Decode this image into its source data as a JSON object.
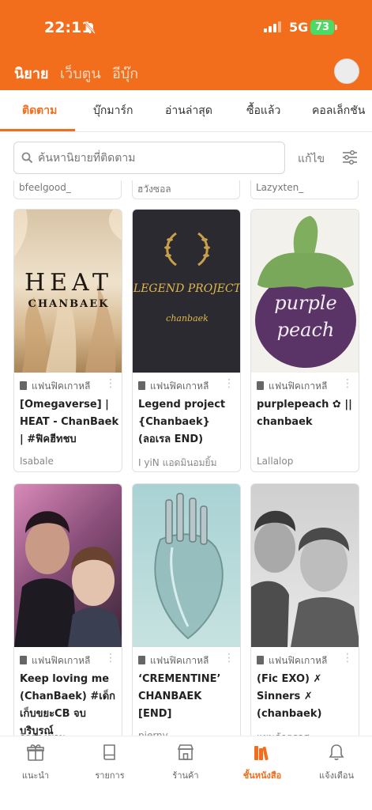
{
  "status_bar": {
    "time": "22:11",
    "network": "5G",
    "battery": "73"
  },
  "header": {
    "tabs": [
      {
        "label": "นิยาย",
        "active": true
      },
      {
        "label": "เว็บตูน",
        "active": false
      },
      {
        "label": "อีบุ๊ก",
        "active": false
      }
    ]
  },
  "subtabs": [
    "ติดตาม",
    "บุ๊กมาร์ก",
    "อ่านล่าสุด",
    "ซื้อแล้ว",
    "คอลเล็กชัน"
  ],
  "search": {
    "placeholder": "ค้นหานิยายที่ติดตาม",
    "edit_label": "แก้ไข"
  },
  "partial_authors": [
    "bfeelgood_",
    "ฮวังซอล",
    "Lazyxten_"
  ],
  "cards": [
    {
      "category": "แฟนฟิคเกาหลี",
      "title": "[Omegaverse] | HEAT - ChanBaek | #ฟิคฮีทชบ",
      "author": "Isabale",
      "cover_text_1": "HEAT",
      "cover_text_2": "CHANBAEK"
    },
    {
      "category": "แฟนฟิคเกาหลี",
      "title": "Legend project {Chanbaek} (ลอเรล END)",
      "author": "I yiN แอดมินอมยิ้ม",
      "cover_text_1": "LEGEND PROJECT",
      "cover_text_2": "chanbaek"
    },
    {
      "category": "แฟนฟิคเกาหลี",
      "title": "purplepeach ✿ || chanbaek",
      "author": "Lallalop",
      "cover_text_1": "purple",
      "cover_text_2": "peach"
    },
    {
      "category": "แฟนฟิคเกาหลี",
      "title": "Keep loving me (ChanBaek) #เด็กเก็บขยะCB จบบริบูรณ์",
      "author": "ลิวตองซาน"
    },
    {
      "category": "แฟนฟิคเกาหลี",
      "title": "‘CREMENTINE’ CHANBAEK [END]",
      "author": "pierny"
    },
    {
      "category": "แฟนฟิคเกาหลี",
      "title": "(Fic EXO) ✗ Sinners ✗ (chanbaek)",
      "author": "แผนค้าตรลส"
    }
  ],
  "bottom_nav": [
    {
      "label": "แนะนำ",
      "icon": "gift-icon"
    },
    {
      "label": "รายการ",
      "icon": "book-icon"
    },
    {
      "label": "ร้านค้า",
      "icon": "store-icon"
    },
    {
      "label": "ชั้นหนังสือ",
      "icon": "bookshelf-icon",
      "active": true
    },
    {
      "label": "แจ้งเตือน",
      "icon": "bell-icon"
    }
  ],
  "colors": {
    "brand": "#f26d1c",
    "battery": "#4cd964"
  }
}
